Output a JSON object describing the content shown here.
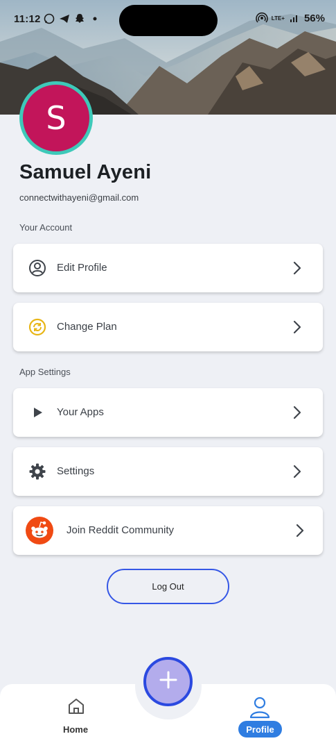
{
  "status_bar": {
    "time": "11:12",
    "battery": "56%",
    "network": "LTE+"
  },
  "profile": {
    "initial": "S",
    "name": "Samuel Ayeni",
    "email": "connectwithayeni@gmail.com",
    "avatar_color": "#c2155a",
    "ring_color": "#3ec9b9"
  },
  "sections": {
    "account_label": "Your Account",
    "app_settings_label": "App Settings"
  },
  "account_items": [
    {
      "label": "Edit Profile",
      "icon": "user-circle-icon"
    },
    {
      "label": "Change Plan",
      "icon": "refresh-coin-icon"
    }
  ],
  "app_items": [
    {
      "label": "Your Apps",
      "icon": "play-icon"
    },
    {
      "label": "Settings",
      "icon": "gear-icon"
    },
    {
      "label": "Join Reddit Community",
      "icon": "reddit-icon"
    }
  ],
  "logout_label": "Log Out",
  "bottom_nav": {
    "home_label": "Home",
    "profile_label": "Profile",
    "active": "Profile",
    "accent": "#2f7de1"
  }
}
